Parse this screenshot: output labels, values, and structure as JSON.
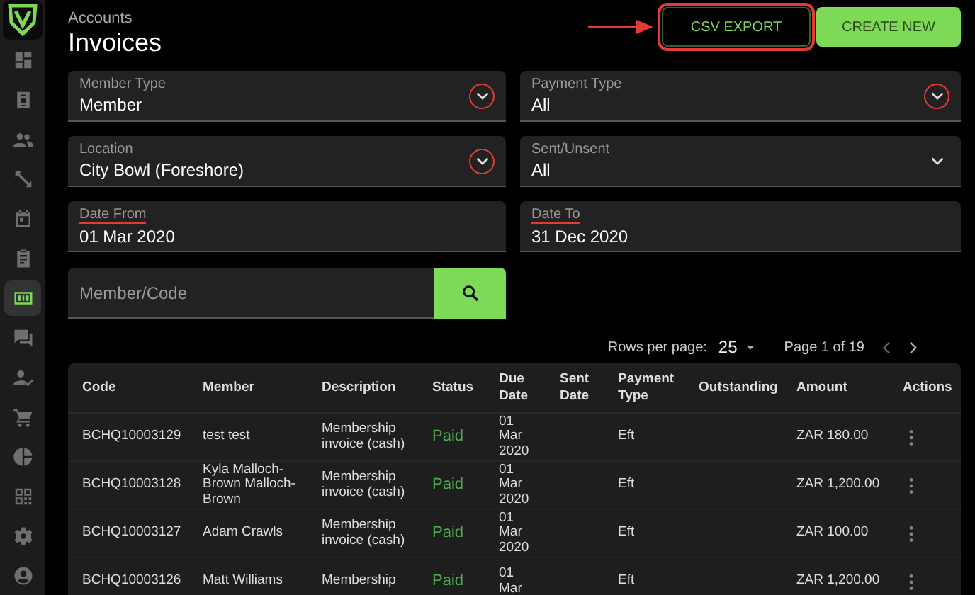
{
  "sidebar": {
    "items": [
      {
        "selected": false
      },
      {
        "selected": false
      },
      {
        "selected": false
      },
      {
        "selected": false
      },
      {
        "selected": false
      },
      {
        "selected": false
      },
      {
        "selected": true
      },
      {
        "selected": false
      },
      {
        "selected": false
      },
      {
        "selected": false
      },
      {
        "selected": false
      },
      {
        "selected": false
      },
      {
        "selected": false
      },
      {
        "selected": false
      }
    ]
  },
  "header": {
    "breadcrumb": "Accounts",
    "title": "Invoices"
  },
  "actions": [
    {
      "label": "CSV EXPORT",
      "kind": "outline",
      "annotated": true
    },
    {
      "label": "CREATE NEW",
      "kind": "filled",
      "annotated": false
    }
  ],
  "filters": [
    {
      "label": "Member Type",
      "value": "Member",
      "kind": "select",
      "annotated": true
    },
    {
      "label": "Payment Type",
      "value": "All",
      "kind": "select",
      "annotated": true
    },
    {
      "label": "Location",
      "value": "City Bowl (Foreshore)",
      "kind": "select",
      "annotated": true
    },
    {
      "label": "Sent/Unsent",
      "value": "All",
      "kind": "select",
      "annotated": false
    },
    {
      "label": "Date From",
      "value": "01 Mar 2020",
      "kind": "date",
      "annotated": true
    },
    {
      "label": "Date To",
      "value": "31 Dec 2020",
      "kind": "date",
      "annotated": true
    }
  ],
  "search": {
    "placeholder": "Member/Code"
  },
  "pagination": {
    "rows_per_page_label": "Rows per page:",
    "rows_per_page": "25",
    "page": "Page 1 of 19"
  },
  "table": {
    "columns": [
      "Code",
      "Member",
      "Description",
      "Status",
      "Due Date",
      "Sent Date",
      "Payment Type",
      "Outstanding",
      "Amount",
      "Actions"
    ],
    "rows": [
      {
        "code": "BCHQ10003129",
        "member": "test test",
        "description": "Membership invoice (cash)",
        "status": "Paid",
        "due_date": "01 Mar 2020",
        "sent_date": "",
        "payment_type": "Eft",
        "outstanding": "",
        "amount": "ZAR 180.00"
      },
      {
        "code": "BCHQ10003128",
        "member": "Kyla Malloch-Brown Malloch-Brown",
        "description": "Membership invoice (cash)",
        "status": "Paid",
        "due_date": "01 Mar 2020",
        "sent_date": "",
        "payment_type": "Eft",
        "outstanding": "",
        "amount": "ZAR 1,200.00"
      },
      {
        "code": "BCHQ10003127",
        "member": "Adam Crawls",
        "description": "Membership invoice (cash)",
        "status": "Paid",
        "due_date": "01 Mar 2020",
        "sent_date": "",
        "payment_type": "Eft",
        "outstanding": "",
        "amount": "ZAR 100.00"
      },
      {
        "code": "BCHQ10003126",
        "member": "Matt Williams",
        "description": "Membership",
        "status": "Paid",
        "due_date": "01 Mar",
        "sent_date": "",
        "payment_type": "Eft",
        "outstanding": "",
        "amount": "ZAR 1,200.00"
      }
    ]
  }
}
